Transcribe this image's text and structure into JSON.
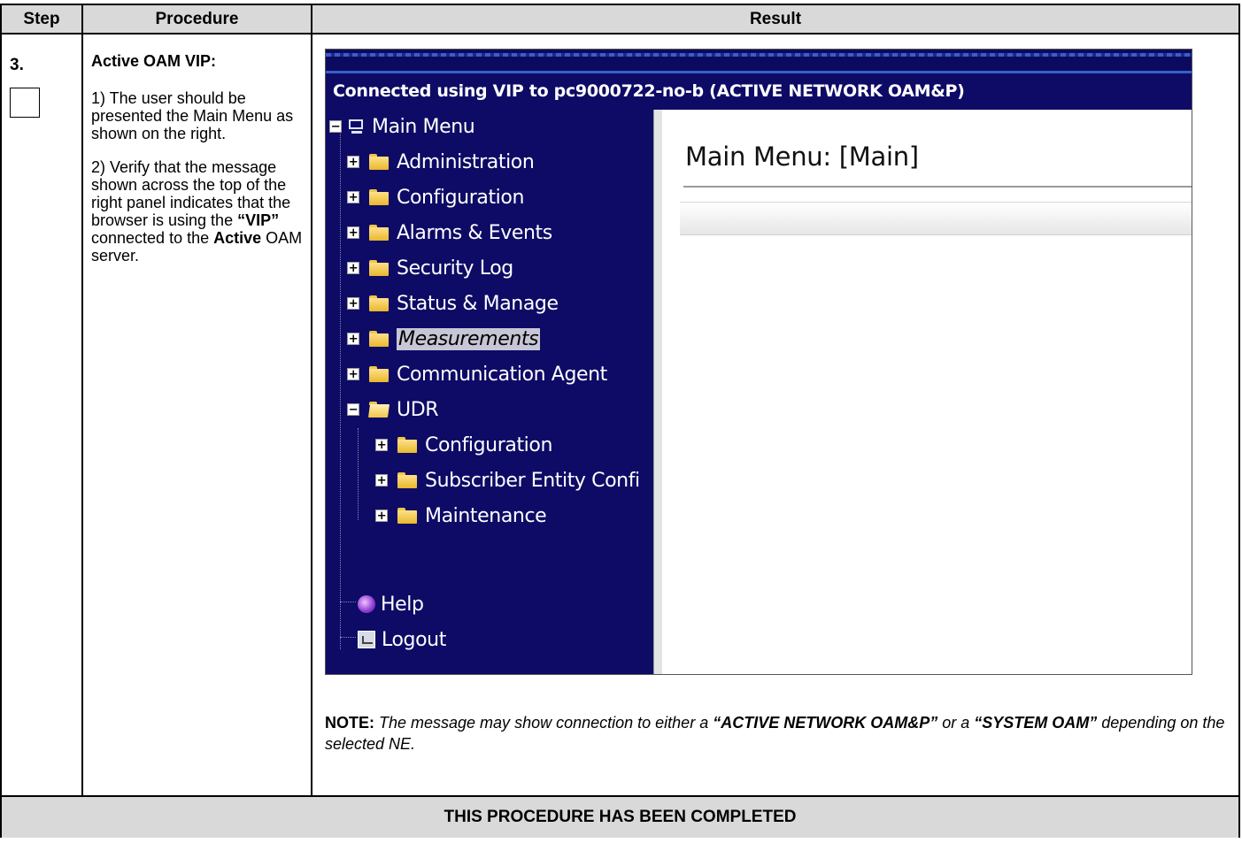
{
  "table": {
    "headers": {
      "step": "Step",
      "procedure": "Procedure",
      "result": "Result"
    },
    "step_number": "3.",
    "procedure": {
      "title": "Active OAM VIP:",
      "para1": "1) The user should be presented the Main Menu as shown on the right.",
      "para2_part1": "2) Verify that the message shown across the top of the right panel indicates that the browser is using the ",
      "para2_vip": "“VIP”",
      "para2_part2": " connected to the ",
      "para2_active": "Active",
      "para2_part3": " OAM server."
    },
    "footer": "THIS PROCEDURE HAS BEEN COMPLETED"
  },
  "screenshot": {
    "connection_message": "Connected using VIP to pc9000722-no-b (ACTIVE NETWORK OAM&P)",
    "tree": {
      "root": "Main Menu",
      "items": [
        {
          "label": "Administration"
        },
        {
          "label": "Configuration"
        },
        {
          "label": "Alarms & Events"
        },
        {
          "label": "Security Log"
        },
        {
          "label": "Status & Manage"
        },
        {
          "label": "Measurements"
        },
        {
          "label": "Communication Agent"
        },
        {
          "label": "UDR"
        }
      ],
      "udr_children": [
        {
          "label": "Configuration"
        },
        {
          "label": "Subscriber Entity Confi"
        },
        {
          "label": "Maintenance"
        }
      ],
      "help": "Help",
      "logout": "Logout"
    },
    "content_title": "Main Menu: [Main]"
  },
  "note": {
    "label": "NOTE:",
    "text1": " The message may show connection to either a ",
    "option1": "“ACTIVE NETWORK OAM&P”",
    "text2": " or a ",
    "option2": "“SYSTEM OAM”",
    "text3": " depending on the selected NE."
  }
}
